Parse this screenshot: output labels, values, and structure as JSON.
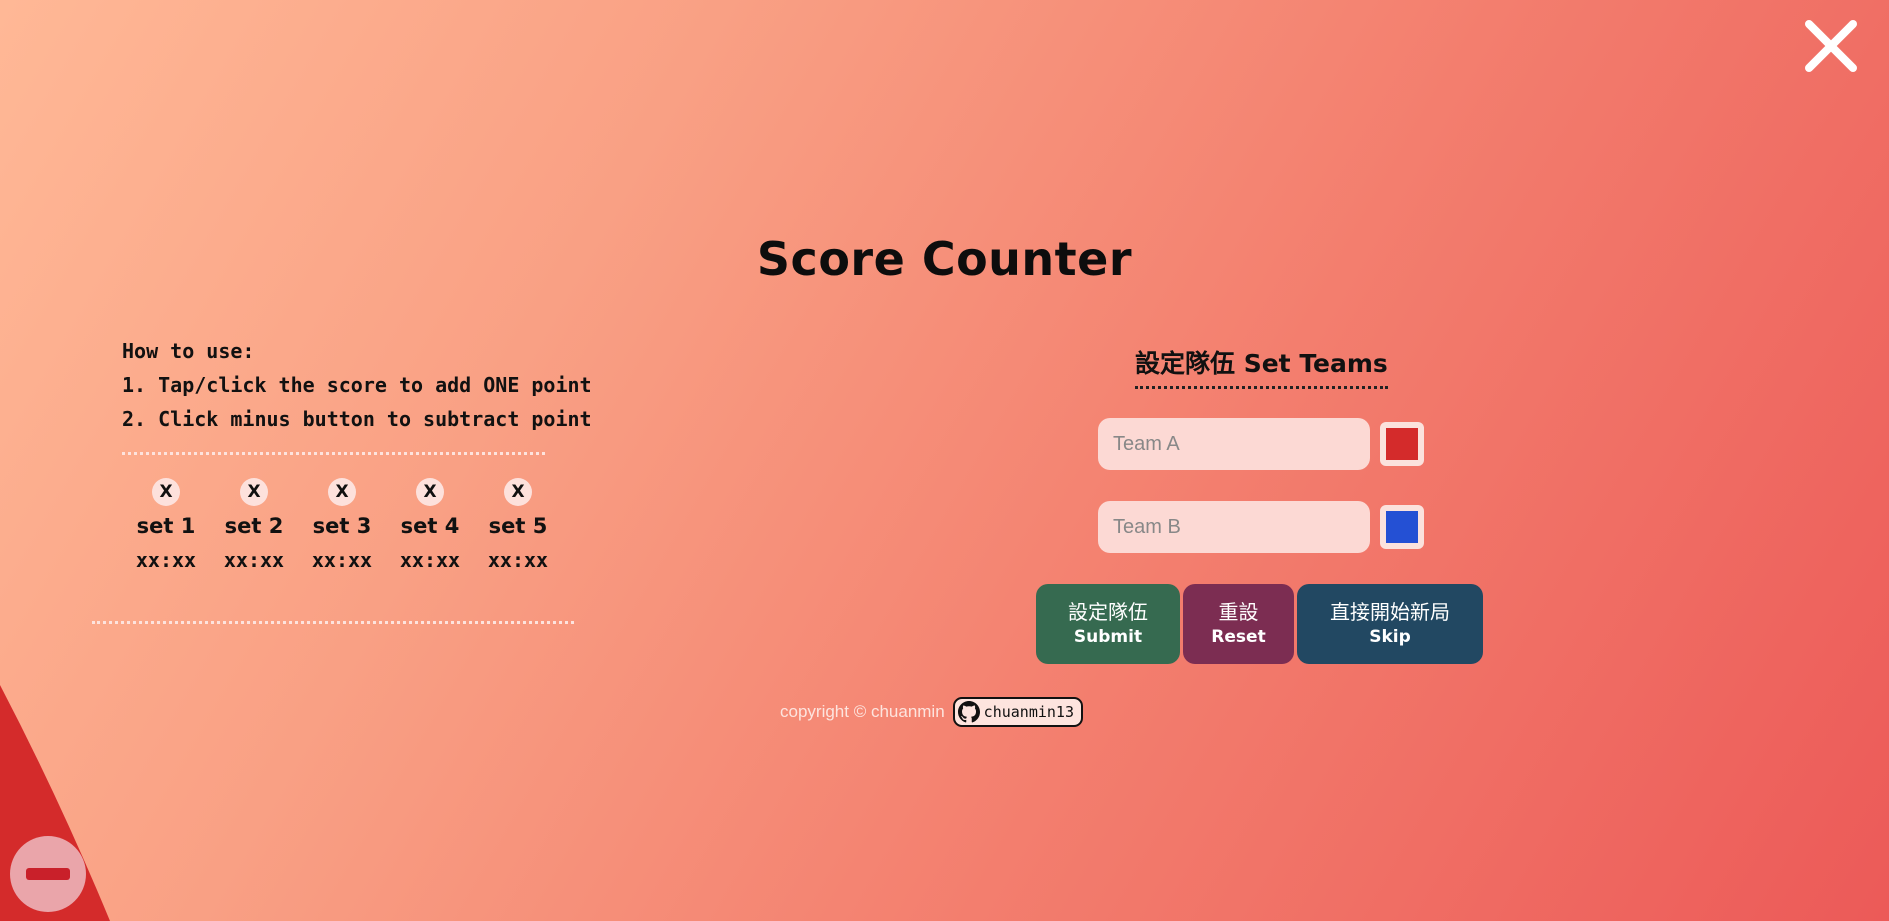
{
  "page": {
    "title": "Score Counter"
  },
  "instructions": {
    "heading": "How to use:",
    "line1": "1. Tap/click the score to add ONE point",
    "line2": "2. Click minus button to subtract point"
  },
  "sets": [
    {
      "remove_label": "X",
      "label": "set 1",
      "score": "xx:xx"
    },
    {
      "remove_label": "X",
      "label": "set 2",
      "score": "xx:xx"
    },
    {
      "remove_label": "X",
      "label": "set 3",
      "score": "xx:xx"
    },
    {
      "remove_label": "X",
      "label": "set 4",
      "score": "xx:xx"
    },
    {
      "remove_label": "X",
      "label": "set 5",
      "score": "xx:xx"
    }
  ],
  "set_teams": {
    "title": "設定隊伍 Set Teams",
    "team_a": {
      "placeholder": "Team A",
      "color": "#d42b2b"
    },
    "team_b": {
      "placeholder": "Team B",
      "color": "#2450d4"
    }
  },
  "actions": {
    "submit": {
      "zh": "設定隊伍",
      "en": "Submit"
    },
    "reset": {
      "zh": "重設",
      "en": "Reset"
    },
    "skip": {
      "zh": "直接開始新局",
      "en": "Skip"
    }
  },
  "footer": {
    "copyright": "copyright © chuanmin",
    "github_handle": "chuanmin13",
    "github_icon": "github-icon"
  },
  "icons": {
    "close": "close-icon",
    "minus": "minus-icon"
  },
  "colors": {
    "accent_red": "#d42b2b",
    "submit_bg": "#366a50",
    "reset_bg": "#7c2d52",
    "skip_bg": "#224862"
  }
}
